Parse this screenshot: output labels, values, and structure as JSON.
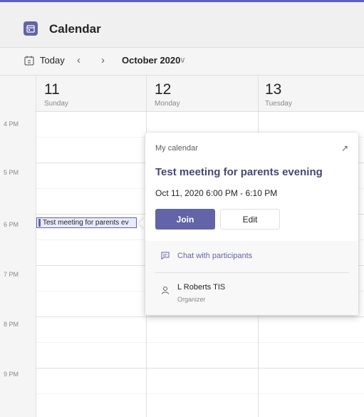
{
  "app": {
    "title": "Calendar",
    "icon": "calendar-app-icon",
    "accent": "#6264a7"
  },
  "toolbar": {
    "today_label": "Today",
    "prev_icon": "chevron-left-icon",
    "next_icon": "chevron-right-icon",
    "month_label": "October 2020",
    "month_dropdown_icon": "chevron-down-icon"
  },
  "days": [
    {
      "num": "11",
      "name": "Sunday"
    },
    {
      "num": "12",
      "name": "Monday"
    },
    {
      "num": "13",
      "name": "Tuesday"
    }
  ],
  "times": [
    "4 PM",
    "5 PM",
    "6 PM",
    "7 PM",
    "8 PM",
    "9 PM"
  ],
  "event_chip": {
    "label": "Test meeting for parents ev"
  },
  "popup": {
    "calendar_label": "My calendar",
    "expand_icon": "expand-icon",
    "title": "Test meeting for parents evening",
    "datetime": "Oct 11, 2020 6:00 PM - 6:10 PM",
    "join_label": "Join",
    "edit_label": "Edit",
    "chat_label": "Chat with participants",
    "chat_icon": "chat-icon",
    "organizer_name": "L Roberts TIS",
    "organizer_role": "Organizer",
    "organizer_icon": "person-icon"
  }
}
